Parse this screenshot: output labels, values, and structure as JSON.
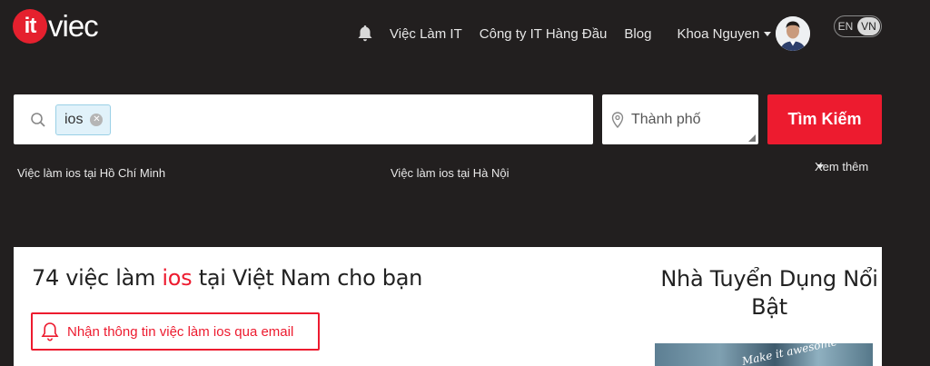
{
  "header": {
    "logo": {
      "mark": "it",
      "text": "viec"
    },
    "nav_items": [
      "Việc Làm IT",
      "Công ty IT Hàng Đầu",
      "Blog"
    ],
    "user_name": "Khoa Nguyen",
    "lang": {
      "en": "EN",
      "vn": "VN",
      "active": "VN"
    }
  },
  "search": {
    "tag": "ios",
    "city_placeholder": "Thành phố",
    "button_label": "Tìm Kiếm"
  },
  "quick_links": {
    "hcm": "Việc làm ios tại Hồ Chí Minh",
    "hn": "Việc làm ios tại Hà Nội",
    "more": "Xem thêm"
  },
  "results": {
    "count_prefix": "74 việc làm ",
    "keyword": "ios",
    "suffix": " tại Việt Nam cho bạn",
    "subscribe_label": "Nhận thông tin việc làm ios qua email"
  },
  "featured": {
    "title": "Nhà Tuyển Dụng Nổi Bật"
  },
  "colors": {
    "background": "#221f1f",
    "brand_red": "#ed1b2f",
    "panel": "#ffffff"
  }
}
